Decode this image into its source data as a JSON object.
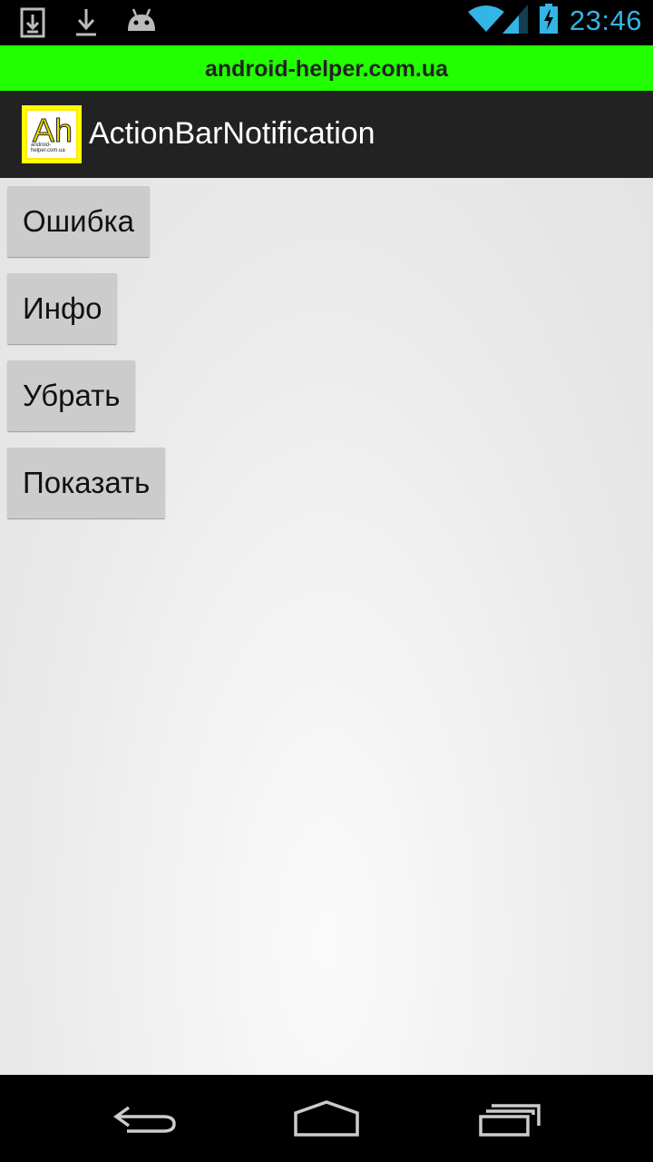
{
  "status_bar": {
    "time": "23:46",
    "icons_left": [
      "download-box-icon",
      "download-icon",
      "android-icon"
    ],
    "icons_right": [
      "wifi-icon",
      "signal-icon",
      "battery-charging-icon"
    ],
    "accent_color": "#33b5e5"
  },
  "banner": {
    "text": "android-helper.com.ua",
    "background": "#22ff00"
  },
  "action_bar": {
    "logo_text": "Ah",
    "logo_subtext": "android-helper.com.ua",
    "title": "ActionBarNotification"
  },
  "buttons": {
    "error_label": "Ошибка",
    "info_label": "Инфо",
    "remove_label": "Убрать",
    "show_label": "Показать"
  },
  "nav_bar": {
    "icons": [
      "back-icon",
      "home-icon",
      "recents-icon"
    ]
  }
}
